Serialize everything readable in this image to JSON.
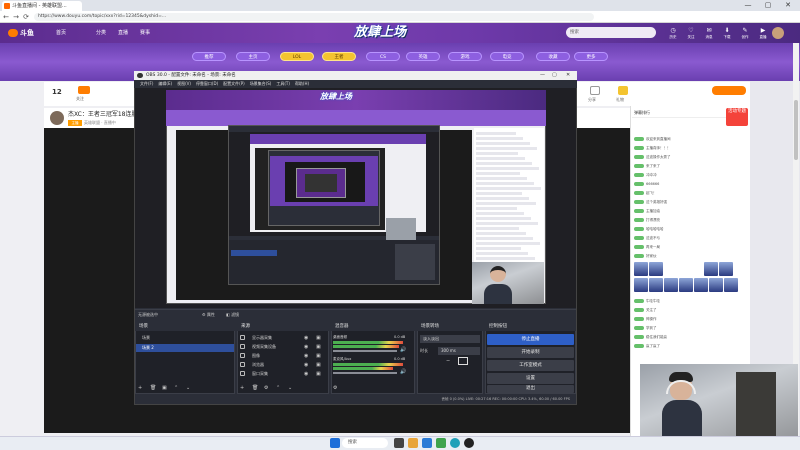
{
  "browser": {
    "tab_title": "斗鱼直播间 - 英雄联盟...",
    "url": "https://www.douyu.com/topic/xxx?rid=12345&dyshid=...",
    "controls": {
      "back": "←",
      "forward": "→",
      "reload": "⟳",
      "minimize": "—",
      "maximize": "▢",
      "close": "✕"
    }
  },
  "site": {
    "logo": "斗鱼",
    "nav": [
      "首页",
      "分类",
      "直播",
      "赛事"
    ],
    "banner_title": "放肆上场",
    "search_placeholder": "搜索",
    "header_icons": [
      {
        "name": "history-icon",
        "glyph": "◷",
        "label": "历史"
      },
      {
        "name": "follow-icon",
        "glyph": "♡",
        "label": "关注"
      },
      {
        "name": "message-icon",
        "glyph": "✉",
        "label": "消息"
      },
      {
        "name": "download-icon",
        "glyph": "⬇",
        "label": "下载"
      },
      {
        "name": "create-icon",
        "glyph": "✎",
        "label": "创作"
      },
      {
        "name": "live-icon",
        "glyph": "▶",
        "label": "直播"
      }
    ],
    "categories": [
      "推荐",
      "主页",
      "LOL",
      "王者",
      "CS",
      "英雄",
      "游戏",
      "电竞",
      "收藏",
      "更多"
    ]
  },
  "room": {
    "title": "杰XC：王者三冠军18连胜",
    "tag": "主播",
    "subtitle": "英雄联盟 · 直播中",
    "stats": [
      "12",
      "关注",
      "分享",
      "礼物"
    ],
    "corner_badge": "活动专题"
  },
  "chat": {
    "header": "弹幕排行",
    "lines": [
      "欢迎来到直播间",
      "主播真帅！！！",
      "这波操作太秀了",
      "来了来了",
      "冲冲冲",
      "666666",
      "起飞！",
      "这个英雄好强",
      "主播加油",
      "打得漂亮",
      "哈哈哈哈哈",
      "这波不亏",
      "再来一局",
      "好家伙",
      "牛哇牛哇",
      "关注了",
      "神操作",
      "学到了",
      "稳住我们能赢",
      "赢了赢了"
    ]
  },
  "obs": {
    "title": "OBS 30.0 - 配置文件: 未命名 - 场景: 未命名",
    "menu": [
      "文件(F)",
      "编辑(E)",
      "视图(V)",
      "停靠窗口(D)",
      "配置文件(P)",
      "场景集合(S)",
      "工具(T)",
      "帮助(H)"
    ],
    "bar_labels": [
      "无源被选中",
      "属性",
      "滤镜"
    ],
    "docks": {
      "scenes": {
        "title": "场景",
        "items": [
          "场景",
          "场景 2"
        ]
      },
      "sources": {
        "title": "来源",
        "items": [
          "显示器采集",
          "视频采集设备",
          "图像",
          "浏览器",
          "窗口采集"
        ]
      },
      "mixer": {
        "title": "混音器",
        "channels": [
          {
            "name": "桌面音频",
            "level": "0.0 dB"
          },
          {
            "name": "麦克风/Aux",
            "level": "0.0 dB"
          }
        ]
      },
      "transitions": {
        "title": "场景转场",
        "type": "淡入淡出",
        "duration_label": "时长",
        "duration": "300 ms"
      },
      "controls": {
        "title": "控制按钮",
        "buttons": [
          "停止直播",
          "开始录制",
          "工作室模式",
          "设置",
          "退出"
        ]
      }
    },
    "status": "丢帧 0 (0.0%)   LIVE: 00:27:16   REC: 00:00:00   CPU: 3.4%, 60.00 / 60.00 FPS"
  },
  "taskbar": {
    "search": "搜索"
  },
  "colors": {
    "accent": "#6a3fb0",
    "obs_bg": "#2b2e38",
    "obs_active": "#2e5fc7",
    "brand_orange": "#ff7d00"
  }
}
